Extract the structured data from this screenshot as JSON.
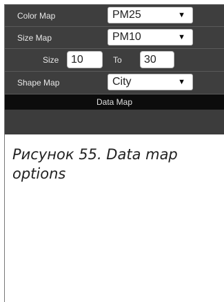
{
  "panel": {
    "color_map": {
      "label": "Color Map",
      "value": "PM25"
    },
    "size_map": {
      "label": "Size Map",
      "value": "PM10"
    },
    "size_range": {
      "label": "Size",
      "from": "10",
      "to_label": "To",
      "to": "30"
    },
    "shape_map": {
      "label": "Shape Map",
      "value": "City"
    },
    "footer_label": "Data Map",
    "dropdown_arrow": "▼"
  },
  "caption": "Рисунок 55. Data map options"
}
